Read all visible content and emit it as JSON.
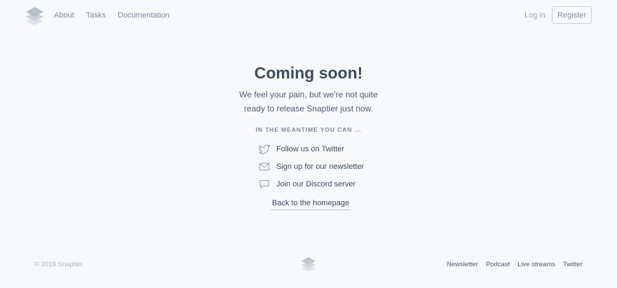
{
  "header": {
    "nav": [
      "About",
      "Tasks",
      "Documentation"
    ],
    "login_label": "Log in",
    "register_label": "Register"
  },
  "main": {
    "title": "Coming soon!",
    "subtitle_line1": "We feel your pain, but we're not quite",
    "subtitle_line2": "ready to release Snaptier just now.",
    "meantime": "IN THE MEANTIME YOU CAN ...",
    "actions": [
      {
        "label": "Follow us on Twitter",
        "icon": "twitter-icon"
      },
      {
        "label": "Sign up for our newsletter",
        "icon": "mail-icon"
      },
      {
        "label": "Join our Discord server",
        "icon": "chat-bubble-icon"
      }
    ],
    "back_label": "Back to the homepage"
  },
  "footer": {
    "copyright": "© 2019 Snaptier",
    "links": [
      "Newsletter",
      "Podcast",
      "Live streams",
      "Twitter"
    ]
  },
  "colors": {
    "background": "#f8f9fb",
    "text_dark": "#3d4b5c",
    "text_muted": "#7d8896",
    "logo_gray": "#c3c9d1"
  }
}
